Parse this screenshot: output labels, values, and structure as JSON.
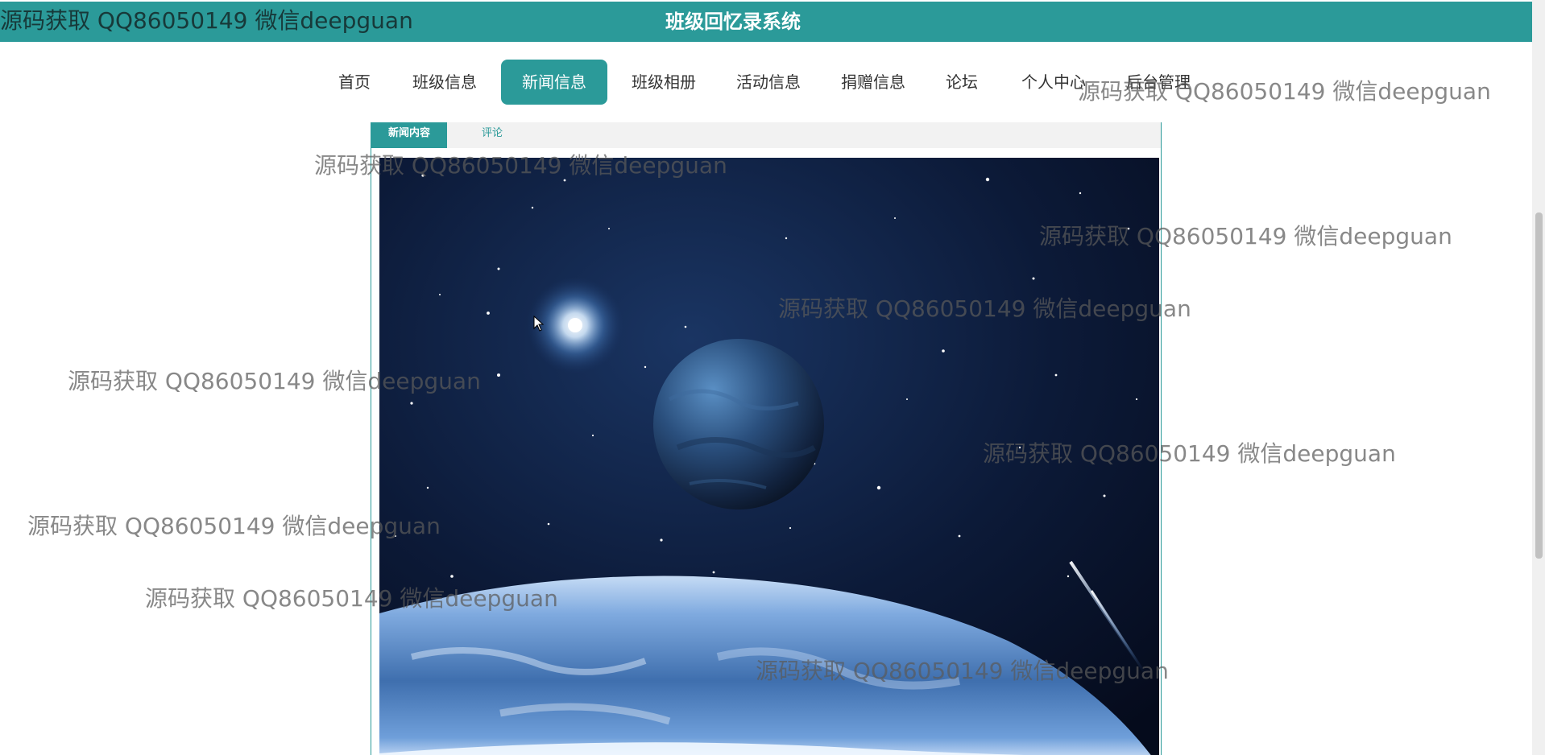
{
  "header": {
    "title": "班级回忆录系统"
  },
  "nav": {
    "items": [
      {
        "label": "首页"
      },
      {
        "label": "班级信息"
      },
      {
        "label": "新闻信息"
      },
      {
        "label": "班级相册"
      },
      {
        "label": "活动信息"
      },
      {
        "label": "捐赠信息"
      },
      {
        "label": "论坛"
      },
      {
        "label": "个人中心"
      },
      {
        "label": "后台管理"
      }
    ],
    "active_label": "新闻信息"
  },
  "content": {
    "tabs": [
      {
        "label": "新闻内容",
        "active": true
      },
      {
        "label": "评论",
        "active": false
      }
    ]
  },
  "watermark": {
    "text": "源码获取 QQ86050149 微信deepguan"
  },
  "colors": {
    "accent": "#2b9a99",
    "header_text": "#ffffff",
    "nav_text": "#333333",
    "tab_bar_bg": "#f2f2f2"
  },
  "icons": {
    "cursor": "mouse-pointer-icon"
  }
}
